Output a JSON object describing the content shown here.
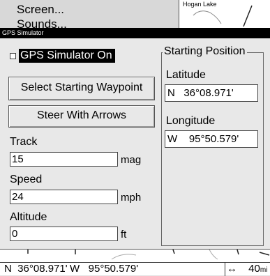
{
  "background_menu": {
    "items": [
      "Screen...",
      "Sounds..."
    ],
    "map_label": "Hogan Lake"
  },
  "dialog": {
    "title": "GPS Simulator",
    "gps_toggle_label": "GPS Simulator On",
    "gps_toggle_checked": false,
    "select_waypoint_label": "Select Starting Waypoint",
    "steer_arrows_label": "Steer With Arrows",
    "track": {
      "label": "Track",
      "value": "15",
      "unit": "mag"
    },
    "speed": {
      "label": "Speed",
      "value": "24",
      "unit": "mph"
    },
    "altitude": {
      "label": "Altitude",
      "value": "0",
      "unit": "ft"
    },
    "starting_position": {
      "title": "Starting Position",
      "latitude_label": "Latitude",
      "latitude_value": "N   36°08.971'",
      "longitude_label": "Longitude",
      "longitude_value": "W    95°50.579'"
    }
  },
  "status_bar": {
    "latitude": "N  36°08.971'",
    "longitude": "W   95°50.579'",
    "range_icon": "double-arrow-icon",
    "range_value": "40",
    "range_unit": "mi"
  }
}
